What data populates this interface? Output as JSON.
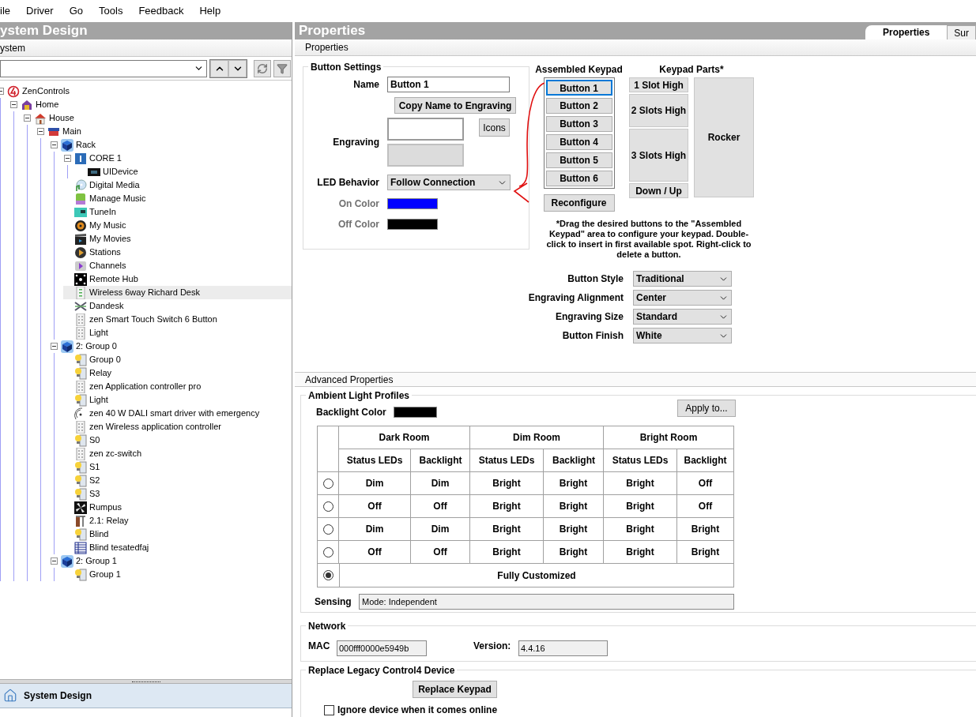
{
  "menu": [
    "ile",
    "Driver",
    "Go",
    "Tools",
    "Feedback",
    "Help"
  ],
  "left_panel": {
    "title": "ystem Design",
    "tab": "ystem",
    "tree": [
      {
        "label": "ZenControls",
        "kind": "brand",
        "expanded": true,
        "selected": false,
        "children": [
          {
            "label": "Home",
            "kind": "home",
            "expanded": true,
            "selected": false,
            "children": [
              {
                "label": "House",
                "kind": "house",
                "expanded": true,
                "selected": false,
                "children": [
                  {
                    "label": "Main",
                    "kind": "room",
                    "expanded": true,
                    "selected": false,
                    "children": [
                      {
                        "label": "Rack",
                        "kind": "cube",
                        "expanded": true,
                        "selected": false,
                        "children": [
                          {
                            "label": "CORE 1",
                            "kind": "core",
                            "expanded": true,
                            "selected": false,
                            "children": [
                              {
                                "label": "UIDevice",
                                "kind": "display",
                                "selected": false
                              }
                            ]
                          },
                          {
                            "label": "Digital Media",
                            "kind": "media",
                            "selected": false
                          },
                          {
                            "label": "Manage Music",
                            "kind": "app",
                            "selected": false
                          },
                          {
                            "label": "TuneIn",
                            "kind": "tunein",
                            "selected": false
                          },
                          {
                            "label": "My Music",
                            "kind": "speaker",
                            "selected": false
                          },
                          {
                            "label": "My Movies",
                            "kind": "film",
                            "selected": false
                          },
                          {
                            "label": "Stations",
                            "kind": "play",
                            "selected": false
                          },
                          {
                            "label": "Channels",
                            "kind": "channel",
                            "selected": false
                          },
                          {
                            "label": "Remote Hub",
                            "kind": "hub",
                            "selected": false
                          },
                          {
                            "label": "Wireless 6way Richard Desk",
                            "kind": "keypad",
                            "selected": true
                          },
                          {
                            "label": "Dandesk",
                            "kind": "crossed",
                            "selected": false
                          },
                          {
                            "label": "zen Smart Touch Switch 6 Button",
                            "kind": "panel",
                            "selected": false
                          },
                          {
                            "label": "Light",
                            "kind": "panel",
                            "selected": false
                          }
                        ]
                      },
                      {
                        "label": "2: Group 0",
                        "kind": "cube",
                        "expanded": true,
                        "selected": false,
                        "children": [
                          {
                            "label": "Group 0",
                            "kind": "light",
                            "selected": false
                          },
                          {
                            "label": "Relay",
                            "kind": "light",
                            "selected": false
                          },
                          {
                            "label": "zen Application controller pro",
                            "kind": "panel",
                            "selected": false
                          },
                          {
                            "label": "Light",
                            "kind": "light",
                            "selected": false
                          },
                          {
                            "label": "zen 40 W DALI smart driver with emergency",
                            "kind": "sensor",
                            "selected": false
                          },
                          {
                            "label": "zen Wireless application controller",
                            "kind": "panel",
                            "selected": false
                          },
                          {
                            "label": "S0",
                            "kind": "light",
                            "selected": false
                          },
                          {
                            "label": "zen zc-switch",
                            "kind": "panel",
                            "selected": false
                          },
                          {
                            "label": "S1",
                            "kind": "light",
                            "selected": false
                          },
                          {
                            "label": "S2",
                            "kind": "light",
                            "selected": false
                          },
                          {
                            "label": "S3",
                            "kind": "light",
                            "selected": false
                          },
                          {
                            "label": "Rumpus",
                            "kind": "fan",
                            "selected": false
                          },
                          {
                            "label": "2.1: Relay",
                            "kind": "relay",
                            "selected": false
                          },
                          {
                            "label": "Blind",
                            "kind": "light",
                            "selected": false
                          },
                          {
                            "label": "Blind tesatedfaj",
                            "kind": "blind",
                            "selected": false
                          }
                        ]
                      },
                      {
                        "label": "2: Group 1",
                        "kind": "cube",
                        "expanded": true,
                        "selected": false,
                        "children": [
                          {
                            "label": "Group 1",
                            "kind": "light",
                            "selected": false
                          }
                        ]
                      }
                    ]
                  }
                ]
              }
            ]
          }
        ]
      }
    ],
    "nav": "System Design"
  },
  "right_panel": {
    "title": "Properties",
    "tabs": [
      {
        "label": "Properties",
        "selected": true
      },
      {
        "label": "Sur",
        "selected": false
      }
    ],
    "section": "Properties",
    "button_settings": {
      "title": "Button Settings",
      "name_label": "Name",
      "name_value": "Button 1",
      "copy_button": "Copy Name to Engraving",
      "engraving_label": "Engraving",
      "engraving_fields": [
        {
          "disabled": false
        },
        {
          "disabled": true
        }
      ],
      "icons_button": "Icons",
      "led_label": "LED Behavior",
      "led_value": "Follow Connection",
      "colors": [
        {
          "label": "On Color",
          "disabled": true,
          "color": "#0000ff"
        },
        {
          "label": "Off Color",
          "disabled": true,
          "color": "#000000"
        }
      ]
    },
    "assembled_keypad": {
      "title": "Assembled Keypad",
      "buttons": [
        {
          "label": "Button 1",
          "selected": true
        },
        {
          "label": "Button 2",
          "selected": false
        },
        {
          "label": "Button 3",
          "selected": false
        },
        {
          "label": "Button 4",
          "selected": false
        },
        {
          "label": "Button 5",
          "selected": false
        },
        {
          "label": "Button 6",
          "selected": false
        }
      ],
      "reconfigure": "Reconfigure"
    },
    "keypad_parts": {
      "title": "Keypad Parts*",
      "parts": [
        {
          "label": "1 Slot High",
          "kind": "single"
        },
        {
          "label": "2 Slots High",
          "kind": "double"
        },
        {
          "label": "3 Slots High",
          "kind": "triple"
        },
        {
          "label": "Down / Up",
          "kind": "single"
        },
        {
          "label": "Rocker",
          "kind": "rocker"
        }
      ]
    },
    "note": "*Drag the desired buttons to the \"Assembled Keypad\" area to configure your keypad.  Double-click to insert in first available spot.  Right-click to delete a button.",
    "options": [
      {
        "label": "Button Style",
        "value": "Traditional"
      },
      {
        "label": "Engraving Alignment",
        "value": "Center"
      },
      {
        "label": "Engraving Size",
        "value": "Standard"
      },
      {
        "label": "Button Finish",
        "value": "White"
      }
    ],
    "advanced": {
      "title": "Advanced Properties",
      "ambient": {
        "title": "Ambient Light Profiles",
        "backlight": {
          "label": "Backlight Color",
          "color": "#000000"
        },
        "apply_button": "Apply to...",
        "groups": [
          "Dark Room",
          "Dim Room",
          "Bright Room"
        ],
        "subcolumns": [
          "Status LEDs",
          "Backlight",
          "Status LEDs",
          "Backlight",
          "Status LEDs",
          "Backlight"
        ],
        "rows": [
          {
            "kind": "preset",
            "selected": false,
            "values": [
              "Dim",
              "Dim",
              "Bright",
              "Bright",
              "Bright",
              "Off"
            ]
          },
          {
            "kind": "preset",
            "selected": false,
            "values": [
              "Off",
              "Off",
              "Bright",
              "Bright",
              "Bright",
              "Off"
            ]
          },
          {
            "kind": "preset",
            "selected": false,
            "values": [
              "Dim",
              "Dim",
              "Bright",
              "Bright",
              "Bright",
              "Bright"
            ]
          },
          {
            "kind": "preset",
            "selected": false,
            "values": [
              "Off",
              "Off",
              "Bright",
              "Bright",
              "Bright",
              "Bright"
            ]
          },
          {
            "kind": "custom",
            "selected": true,
            "label": "Fully Customized"
          }
        ],
        "sensing_label": "Sensing",
        "sensing_value": "Mode: Independent"
      },
      "network": {
        "title": "Network",
        "mac_label": "MAC",
        "mac_value": "000fff0000e5949b",
        "version_label": "Version:",
        "version_value": "4.4.16"
      },
      "legacy": {
        "title": "Replace Legacy Control4 Device",
        "button": "Replace Keypad",
        "checkbox_label": "Ignore device when it comes online",
        "checked": false
      }
    }
  }
}
